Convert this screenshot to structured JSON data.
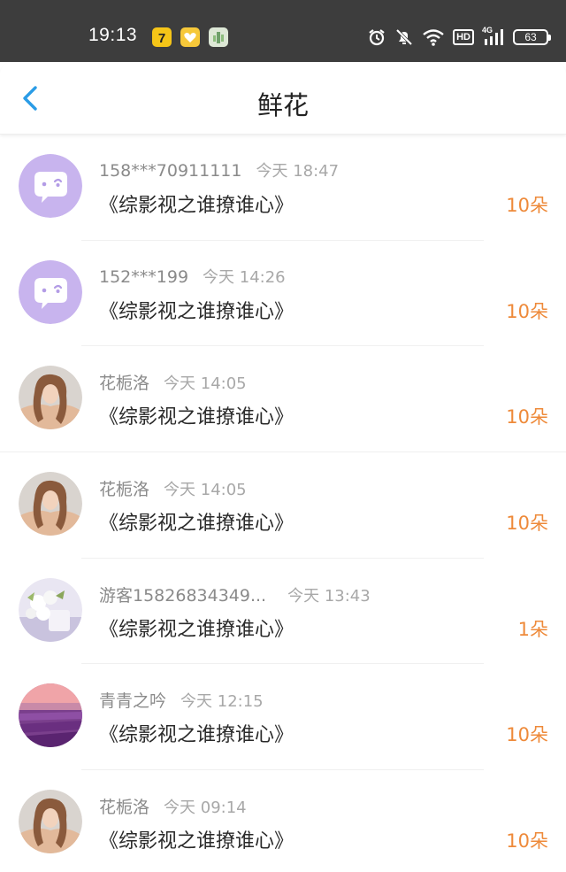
{
  "status_bar": {
    "time": "19:13",
    "battery": "63",
    "hd": "HD",
    "network": "4G",
    "icons": [
      "app-7-icon",
      "app-heart-icon",
      "app-plant-icon",
      "alarm-icon",
      "mute-bell-icon",
      "wifi-icon",
      "hd-icon",
      "signal-icon",
      "battery-icon"
    ]
  },
  "header": {
    "title": "鲜花",
    "back_icon": "chevron-left-icon"
  },
  "colors": {
    "accent_blue": "#2a9ce6",
    "amount_orange": "#ee8a3a",
    "avatar_purple": "#c8b4ee"
  },
  "flowers": [
    {
      "name": "158***70911111",
      "time": "今天 18:47",
      "book": "《综影视之谁撩谁心》",
      "amount": "10朵",
      "avatar": "default"
    },
    {
      "name": "152***199",
      "time": "今天 14:26",
      "book": "《综影视之谁撩谁心》",
      "amount": "10朵",
      "avatar": "default"
    },
    {
      "name": "花栀洛",
      "time": "今天 14:05",
      "book": "《综影视之谁撩谁心》",
      "amount": "10朵",
      "avatar": "girl"
    },
    {
      "name": "花栀洛",
      "time": "今天 14:05",
      "book": "《综影视之谁撩谁心》",
      "amount": "10朵",
      "avatar": "girl"
    },
    {
      "name": "游客15826834349...",
      "time": "今天 13:43",
      "book": "《综影视之谁撩谁心》",
      "amount": "1朵",
      "avatar": "flower"
    },
    {
      "name": "青青之吟",
      "time": "今天 12:15",
      "book": "《综影视之谁撩谁心》",
      "amount": "10朵",
      "avatar": "lavender"
    },
    {
      "name": "花栀洛",
      "time": "今天 09:14",
      "book": "《综影视之谁撩谁心》",
      "amount": "10朵",
      "avatar": "girl"
    }
  ]
}
